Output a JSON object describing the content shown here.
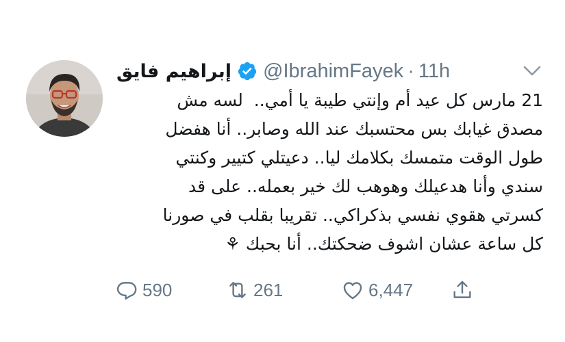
{
  "tweet": {
    "display_name": "إبراهيم فايق",
    "handle": "@IbrahimFayek",
    "separator": "·",
    "time": "11h",
    "text_lines": [
      "21 مارس كل عيد أم وإنتي طيبة يا أمي..  لسه مش",
      "مصدق غيابك بس محتسبك عند الله وصابر.. أنا هفضل",
      "طول الوقت متمسك بكلامك ليا.. دعيتلي كتيير وكنتي",
      "سندي وأنا هدعيلك وهوهب لك خير بعمله.. على قد",
      "كسرتي هقوي نفسي بذكراكي.. تقريبا بقلب في صورنا",
      "كل ساعة عشان اشوف ضحكتك.. أنا بحبك ⚘"
    ],
    "replies": "590",
    "retweets": "261",
    "likes": "6,447",
    "icons": {
      "verified": "verified-badge-icon",
      "caret": "chevron-down-icon",
      "reply": "reply-icon",
      "retweet": "retweet-icon",
      "like": "heart-icon",
      "share": "share-icon"
    },
    "colors": {
      "text": "#14171a",
      "secondary": "#657786",
      "verified": "#1da1f2"
    }
  }
}
